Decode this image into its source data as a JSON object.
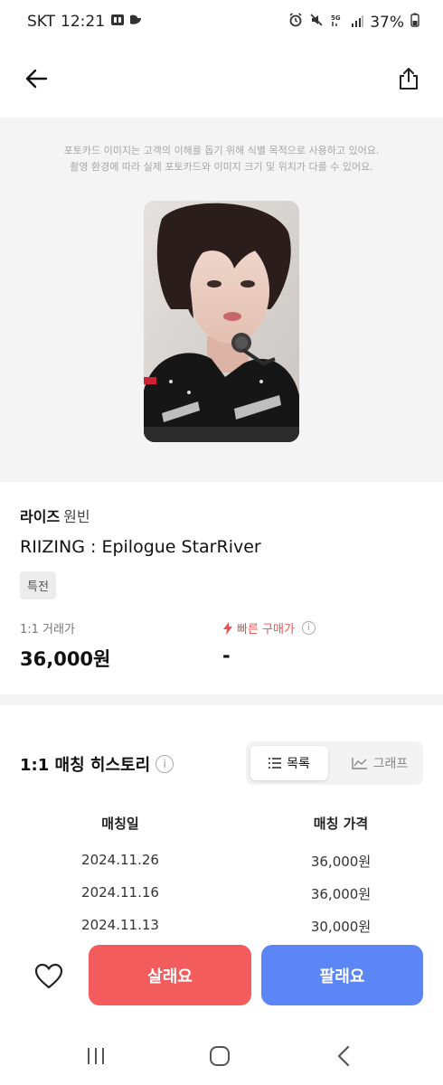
{
  "status_bar": {
    "carrier": "SKT",
    "time": "12:21",
    "battery": "37%"
  },
  "image_section": {
    "disclaimer_line1": "포토카드 이미지는 고객의 이해를 돕기 위해 식별 목적으로 사용하고 있어요.",
    "disclaimer_line2": "촬영 환경에 따라 실제 포토카드와 이미지 크기 및 위치가 다를 수 있어요."
  },
  "product": {
    "artist": "라이즈",
    "member": "원빈",
    "album": "RIIZING : Epilogue StarRiver",
    "badge": "특전",
    "trade_price_label": "1:1 거래가",
    "trade_price": "36,000원",
    "fast_price_label": "빠른 구매가",
    "fast_price": "-"
  },
  "history": {
    "title": "1:1 매칭 히스토리",
    "toggle_list": "목록",
    "toggle_graph": "그래프",
    "col_date": "매칭일",
    "col_price": "매칭 가격",
    "rows": [
      {
        "date": "2024.11.26",
        "price": "36,000원"
      },
      {
        "date": "2024.11.16",
        "price": "36,000원"
      },
      {
        "date": "2024.11.13",
        "price": "30,000원"
      }
    ]
  },
  "actions": {
    "buy": "살래요",
    "sell": "팔래요"
  },
  "colors": {
    "buy": "#f25c5c",
    "sell": "#5c86f5",
    "fast_price": "#ef5050"
  }
}
